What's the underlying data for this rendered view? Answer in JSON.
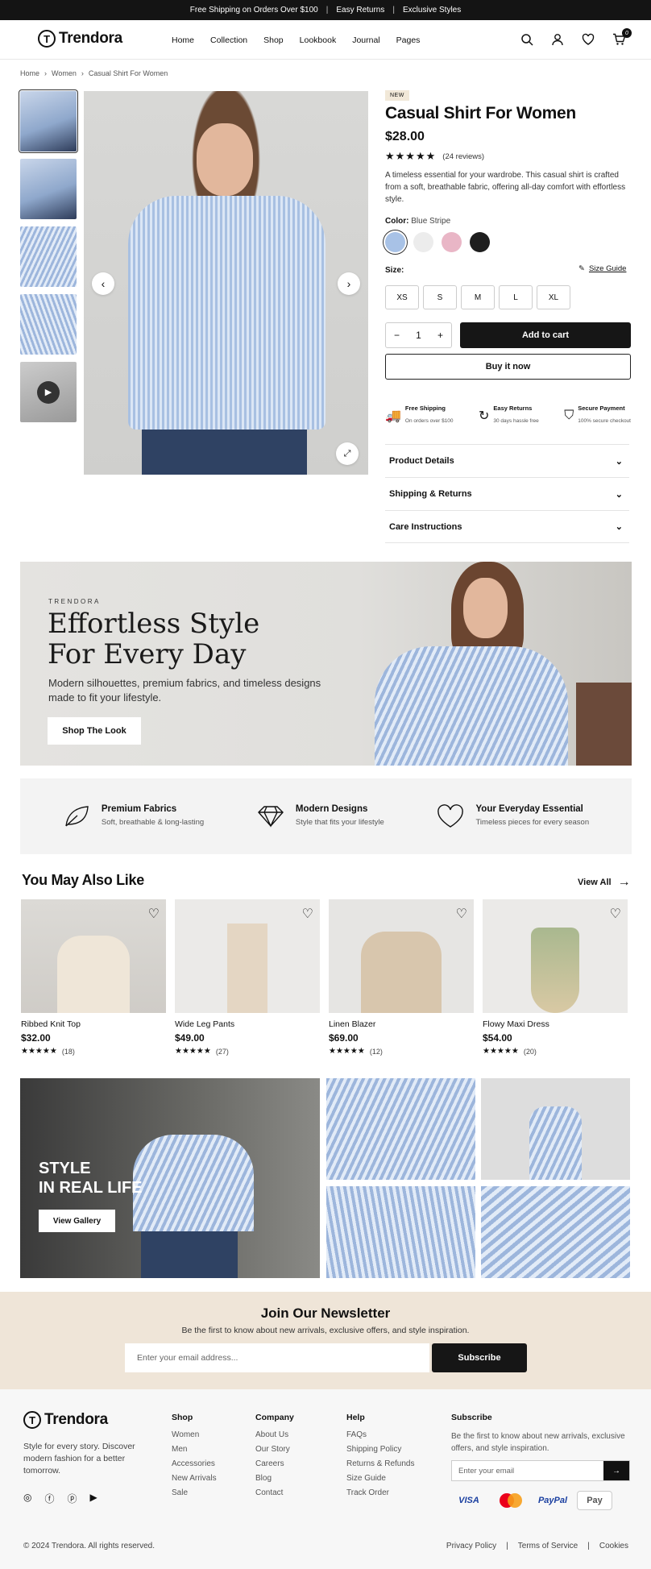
{
  "announcement": [
    "Free Shipping on Orders Over $100",
    "Easy Returns",
    "Exclusive Styles"
  ],
  "brand": "Trendora",
  "logo_letter": "T",
  "nav": [
    "Home",
    "Collection",
    "Shop",
    "Lookbook",
    "Journal",
    "Pages"
  ],
  "cart_count": "0",
  "breadcrumb": [
    "Home",
    "Women",
    "Casual Shirt For Women"
  ],
  "product": {
    "tag": "NEW",
    "title": "Casual Shirt For Women",
    "price": "$28.00",
    "rating": 5,
    "stars": "★★★★★",
    "reviews": "(24 reviews)",
    "description": "A timeless essential for your wardrobe. This casual shirt is crafted from a soft, breathable fabric, offering all-day comfort with effortless style.",
    "color_label": "Color:",
    "color_value": "Blue Stripe",
    "colors": [
      "#a8c2e6",
      "#ececec",
      "#e9b6c6",
      "#1e1e1e"
    ],
    "size_label": "Size:",
    "size_guide": "Size Guide",
    "sizes": [
      "XS",
      "S",
      "M",
      "L",
      "XL"
    ],
    "qty": "1",
    "qty_minus": "−",
    "qty_plus": "+",
    "add_to_cart": "Add to cart",
    "buy_now": "Buy it now",
    "perks": [
      {
        "title": "Free Shipping",
        "sub": "On orders over $100"
      },
      {
        "title": "Easy Returns",
        "sub": "30 days hassle free"
      },
      {
        "title": "Secure Payment",
        "sub": "100% secure checkout"
      }
    ],
    "accordions": [
      "Product Details",
      "Shipping & Returns",
      "Care Instructions"
    ]
  },
  "hero": {
    "brand": "TRENDORA",
    "title_line1": "Effortless Style",
    "title_line2": "For Every Day",
    "text": "Modern silhouettes, premium fabrics, and timeless designs made to fit your lifestyle.",
    "button": "Shop The Look"
  },
  "features": [
    {
      "title": "Premium Fabrics",
      "sub": "Soft, breathable & long-lasting"
    },
    {
      "title": "Modern Designs",
      "sub": "Style that fits your lifestyle"
    },
    {
      "title": "Your Everyday Essential",
      "sub": "Timeless pieces for every season"
    }
  ],
  "related": {
    "title": "You May Also Like",
    "view_all": "View All",
    "items": [
      {
        "name": "Ribbed Knit Top",
        "price": "$32.00",
        "stars": "★★★★★",
        "reviews": "(18)",
        "rating": 4.5
      },
      {
        "name": "Wide Leg Pants",
        "price": "$49.00",
        "stars": "★★★★★",
        "reviews": "(27)",
        "rating": 5
      },
      {
        "name": "Linen Blazer",
        "price": "$69.00",
        "stars": "★★★★★",
        "reviews": "(12)",
        "rating": 4.5
      },
      {
        "name": "Flowy Maxi Dress",
        "price": "$54.00",
        "stars": "★★★★★",
        "reviews": "(20)",
        "rating": 4.5
      }
    ]
  },
  "gallery": {
    "title_line1": "STYLE",
    "title_line2": "IN REAL LIFE",
    "button": "View Gallery"
  },
  "newsletter": {
    "title": "Join Our Newsletter",
    "text": "Be the first to know about new arrivals, exclusive offers, and style inspiration.",
    "placeholder": "Enter your email address...",
    "button": "Subscribe"
  },
  "footer": {
    "tagline": "Style for every story. Discover modern fashion for a better tomorrow.",
    "shop": {
      "title": "Shop",
      "links": [
        "Women",
        "Men",
        "Accessories",
        "New Arrivals",
        "Sale"
      ]
    },
    "company": {
      "title": "Company",
      "links": [
        "About Us",
        "Our Story",
        "Careers",
        "Blog",
        "Contact"
      ]
    },
    "help": {
      "title": "Help",
      "links": [
        "FAQs",
        "Shipping Policy",
        "Returns & Refunds",
        "Size Guide",
        "Track Order"
      ]
    },
    "subscribe": {
      "title": "Subscribe",
      "text": "Be the first to know about new arrivals, exclusive offers, and style inspiration.",
      "placeholder": "Enter your email"
    },
    "payments": [
      "VISA",
      "PayPal",
      "Pay"
    ],
    "copyright": "© 2024 Trendora. All rights reserved.",
    "legal": [
      "Privacy Policy",
      "Terms of Service",
      "Cookies"
    ]
  }
}
